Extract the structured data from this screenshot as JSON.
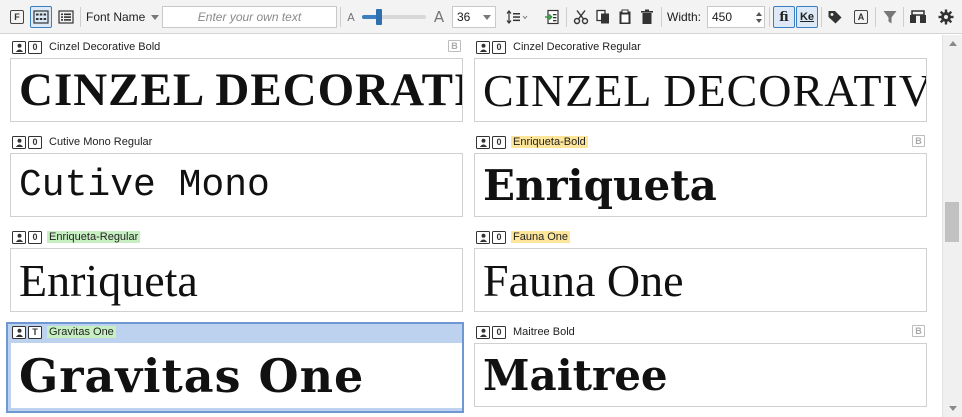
{
  "toolbar": {
    "font_name_label": "Font Name",
    "filter_placeholder": "Enter your own text",
    "font_size_value": "36",
    "width_label": "Width:",
    "width_value": "450",
    "ligature_label": "fi",
    "kerning_label": "Ke",
    "a_small": "A",
    "a_large": "A"
  },
  "fonts": [
    {
      "name": "Cinzel Decorative Bold",
      "sample": "CINZEL DECORATIVE",
      "badge": "B",
      "highlight": "none",
      "type_icon": "0"
    },
    {
      "name": "Cinzel Decorative Regular",
      "sample": "CINZEL DECORATIVE",
      "badge": "",
      "highlight": "none",
      "type_icon": "0"
    },
    {
      "name": "Cutive Mono Regular",
      "sample": "Cutive Mono",
      "badge": "",
      "highlight": "none",
      "type_icon": "0"
    },
    {
      "name": "Enriqueta-Bold",
      "sample": "Enriqueta",
      "badge": "B",
      "highlight": "yellow",
      "type_icon": "0"
    },
    {
      "name": "Enriqueta-Regular",
      "sample": "Enriqueta",
      "badge": "",
      "highlight": "green",
      "type_icon": "0"
    },
    {
      "name": "Fauna One",
      "sample": "Fauna One",
      "badge": "",
      "highlight": "yellow",
      "type_icon": "0"
    },
    {
      "name": "Gravitas One",
      "sample": "Gravitas One",
      "badge": "",
      "highlight": "green",
      "type_icon": "T",
      "selected": true
    },
    {
      "name": "Maitree Bold",
      "sample": "Maitree",
      "badge": "B",
      "highlight": "none",
      "type_icon": "0"
    }
  ],
  "colors": {
    "accent": "#3c7fc1",
    "selection": "#bcd2ef",
    "highlight_yellow": "#fde59a",
    "highlight_green": "#c7f0c2"
  },
  "icons": [
    "font-file-icon",
    "grid-view-icon",
    "list-view-icon",
    "line-spacing-icon",
    "export-icon",
    "cut-icon",
    "copy-icon",
    "paste-icon",
    "delete-icon",
    "tag-icon",
    "font-box-icon",
    "filter-icon",
    "compare-icon",
    "settings-icon"
  ]
}
